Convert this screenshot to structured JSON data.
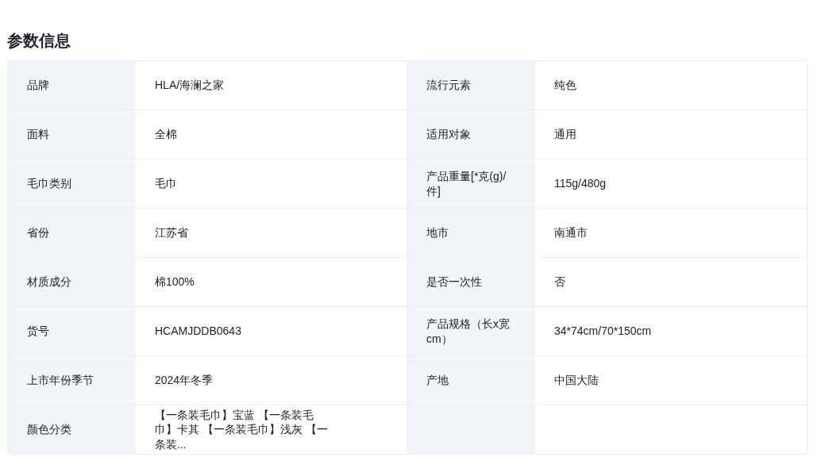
{
  "title": "参数信息",
  "rows": [
    {
      "cells": [
        {
          "label": "品牌",
          "value": "HLA/海澜之家"
        },
        {
          "label": "流行元素",
          "value": "纯色"
        }
      ]
    },
    {
      "cells": [
        {
          "label": "面料",
          "value": "全棉"
        },
        {
          "label": "适用对象",
          "value": "通用"
        }
      ]
    },
    {
      "cells": [
        {
          "label": "毛巾类别",
          "value": "毛巾"
        },
        {
          "label": "产品重量[*克(g)/件]",
          "value": "115g/480g"
        }
      ]
    },
    {
      "cells": [
        {
          "label": "省份",
          "value": "江苏省"
        },
        {
          "label": "地市",
          "value": "南通市"
        }
      ]
    },
    {
      "cells": [
        {
          "label": "材质成分",
          "value": "棉100%"
        },
        {
          "label": "是否一次性",
          "value": "否"
        }
      ]
    },
    {
      "cells": [
        {
          "label": "货号",
          "value": "HCAMJDDB0643"
        },
        {
          "label": "产品规格（长x宽cm）",
          "value": "34*74cm/70*150cm"
        }
      ]
    },
    {
      "cells": [
        {
          "label": "上市年份季节",
          "value": "2024年冬季"
        },
        {
          "label": "产地",
          "value": "中国大陆"
        }
      ]
    },
    {
      "cells": [
        {
          "label": "颜色分类",
          "value": "【一条装毛巾】宝蓝 【一条装毛巾】卡其 【一条装毛巾】浅灰 【一条装..."
        }
      ]
    }
  ]
}
